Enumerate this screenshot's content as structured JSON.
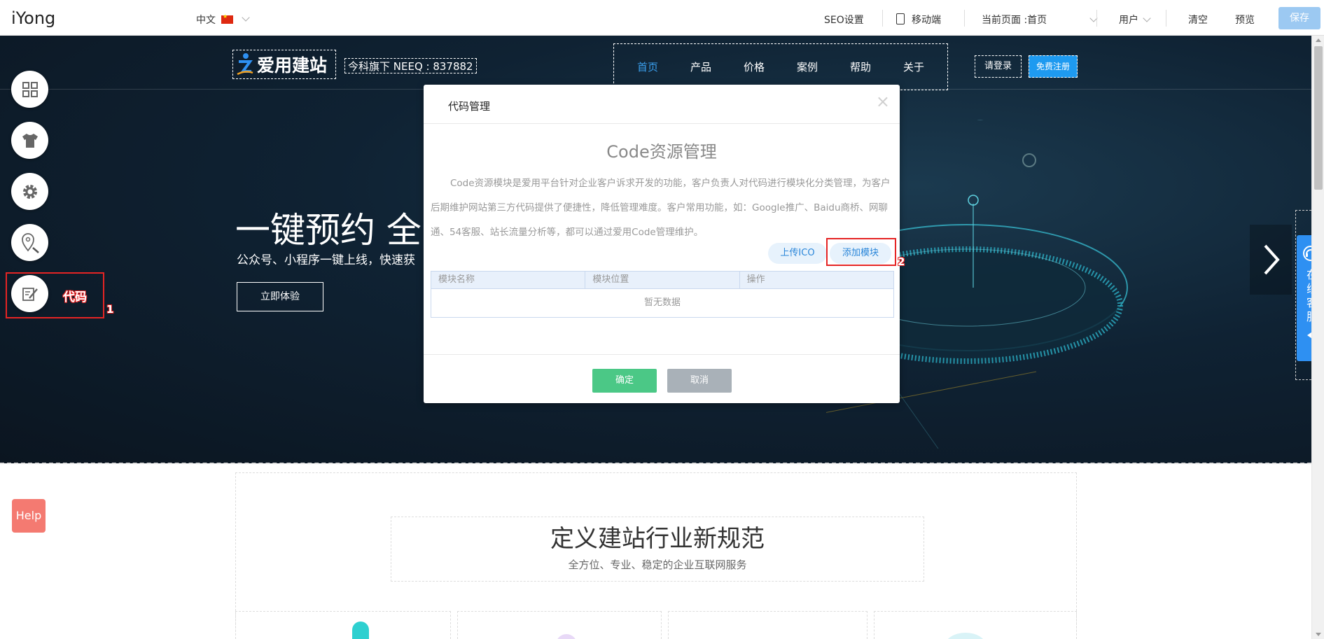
{
  "toolbar": {
    "brand": "iYong",
    "language": "中文",
    "seo": "SEO设置",
    "mobile": "移动端",
    "current_page_label": "当前页面 :首页",
    "user": "用户",
    "clear": "清空",
    "preview": "预览",
    "save": "保存"
  },
  "site": {
    "logo_text": "爱用建站",
    "neeq": "今科旗下 NEEQ : 837882",
    "nav": [
      "首页",
      "产品",
      "价格",
      "案例",
      "帮助",
      "关于"
    ],
    "login": "请登录",
    "register": "免费注册",
    "hero_title": "一键预约 全网",
    "hero_sub": "公众号、小程序一键上线，快速获",
    "try_button": "立即体验",
    "customer_service": "在线客服"
  },
  "dock": {
    "code_label": "代码",
    "marker_1": "1",
    "help": "Help"
  },
  "section": {
    "title": "定义建站行业新规范",
    "subtitle": "全方位、专业、稳定的企业互联网服务"
  },
  "modal": {
    "title": "代码管理",
    "close": "×",
    "heading": "Code资源管理",
    "description": "Code资源模块是爱用平台针对企业客户诉求开发的功能，客户负责人对代码进行模块化分类管理，为客户后期维护网站第三方代码提供了便捷性，降低管理难度。客户常用功能，如：Google推广、Baidu商桥、网聊通、54客服、站长流量分析等，都可以通过爱用Code管理维护。",
    "upload_ico": "上传ICO",
    "add_module": "添加模块",
    "marker_2": "2",
    "columns": [
      "模块名称",
      "模块位置",
      "操作"
    ],
    "empty": "暂无数据",
    "confirm": "确定",
    "cancel": "取消"
  },
  "colors": {
    "accent": "#2e90f2",
    "highlight": "#e52424",
    "confirm": "#4bc886",
    "cancel": "#a9b1b8"
  }
}
